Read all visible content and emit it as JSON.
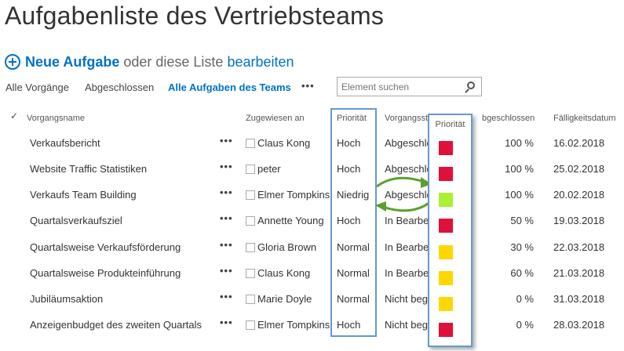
{
  "page": {
    "title": "Aufgabenliste des Vertriebsteams",
    "new_task_label": "Neue Aufgabe",
    "or_text": "oder diese Liste",
    "edit_label": "bearbeiten"
  },
  "views": {
    "all": "Alle Vorgänge",
    "done": "Abgeschlossen",
    "team": "Alle Aufgaben des Teams",
    "more": "•••"
  },
  "search": {
    "placeholder": "Element suchen"
  },
  "table": {
    "check_icon": "✓",
    "headers": {
      "name": "Vorgangsname",
      "assigned": "Zugewiesen an",
      "priority": "Priorität",
      "status": "Vorgangsst",
      "percent": "bgeschlossen",
      "due": "Fälligkeitsdatum"
    },
    "rows": [
      {
        "name": "Verkaufsbericht",
        "dots": "•••",
        "assignee": "Claus Kong",
        "priority": "Hoch",
        "status": "Abgeschlossen",
        "percent": "100 %",
        "due": "16.02.2018"
      },
      {
        "name": "Website Traffic Statistiken",
        "dots": "•••",
        "assignee": "peter",
        "priority": "Hoch",
        "status": "Abgeschlossen",
        "percent": "100 %",
        "due": "25.02.2018"
      },
      {
        "name": "Verkaufs Team Building",
        "dots": "•••",
        "assignee": "Elmer Tompkins",
        "priority": "Niedrig",
        "status": "Abgeschlossen",
        "percent": "100 %",
        "due": "20.02.2018"
      },
      {
        "name": "Quartalsverkaufsziel",
        "dots": "•••",
        "assignee": "Annette Young",
        "priority": "Hoch",
        "status": "In Bearbeitung",
        "percent": "50 %",
        "due": "19.03.2018"
      },
      {
        "name": "Quartalsweise Verkaufsförderung",
        "dots": "•••",
        "assignee": "Gloria Brown",
        "priority": "Normal",
        "status": "In Bearbeitung",
        "percent": "30 %",
        "due": "22.03.2018"
      },
      {
        "name": "Quartalsweise Produkteinführung",
        "dots": "•••",
        "assignee": "Claus Kong",
        "priority": "Normal",
        "status": "In Bearbeitung",
        "percent": "60 %",
        "due": "21.03.2018"
      },
      {
        "name": "Jubiläumsaktion",
        "dots": "•••",
        "assignee": "Marie Doyle",
        "priority": "Normal",
        "status": "Nicht begonnen",
        "percent": "0 %",
        "due": "31.03.2018"
      },
      {
        "name": "Anzeigenbudget des zweiten Quartals",
        "dots": "•••",
        "assignee": "Elmer Tompkins",
        "priority": "Hoch",
        "status": "Nicht begonnen",
        "percent": "0 %",
        "due": "28.03.2018"
      }
    ]
  },
  "color_overlay": {
    "header": "Priorität",
    "swatches": [
      "#e0103a",
      "#e0103a",
      "#aaf033",
      "#e0103a",
      "#ffd700",
      "#ffd700",
      "#ffd700",
      "#e0103a"
    ]
  },
  "colors": {
    "link": "#0072c6",
    "highlight_border": "#6699cc",
    "arrow_green": "#5aa02c"
  }
}
